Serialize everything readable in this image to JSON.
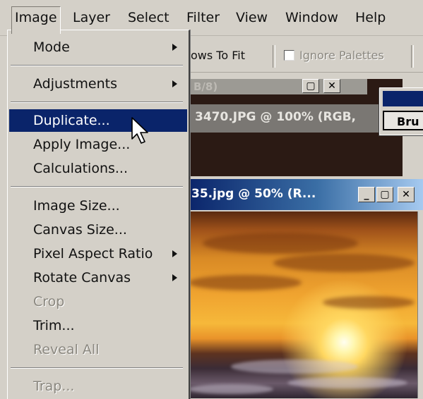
{
  "menubar": {
    "items": [
      "Image",
      "Layer",
      "Select",
      "Filter",
      "View",
      "Window",
      "Help"
    ],
    "active": "Image"
  },
  "toolbar": {
    "fit_windows_label": "ows To Fit",
    "ignore_palettes_label": "Ignore Palettes"
  },
  "windows": {
    "back_partial_title": "B/8)",
    "doc1_title": "3470.JPG @ 100% (RGB,",
    "doc2_title": "35.jpg @ 50% (R..."
  },
  "palette": {
    "tab_label": "Bru"
  },
  "image_menu": {
    "items": [
      {
        "label": "Mode",
        "submenu": true,
        "enabled": true
      },
      {
        "label": "Adjustments",
        "submenu": true,
        "enabled": true
      },
      {
        "label": "Duplicate...",
        "submenu": false,
        "enabled": true,
        "highlighted": true
      },
      {
        "label": "Apply Image...",
        "submenu": false,
        "enabled": true
      },
      {
        "label": "Calculations...",
        "submenu": false,
        "enabled": true
      },
      {
        "label": "Image Size...",
        "submenu": false,
        "enabled": true
      },
      {
        "label": "Canvas Size...",
        "submenu": false,
        "enabled": true
      },
      {
        "label": "Pixel Aspect Ratio",
        "submenu": true,
        "enabled": true
      },
      {
        "label": "Rotate Canvas",
        "submenu": true,
        "enabled": true
      },
      {
        "label": "Crop",
        "submenu": false,
        "enabled": false
      },
      {
        "label": "Trim...",
        "submenu": false,
        "enabled": true
      },
      {
        "label": "Reveal All",
        "submenu": false,
        "enabled": false
      },
      {
        "label": "Trap...",
        "submenu": false,
        "enabled": false
      }
    ]
  },
  "colors": {
    "menu_highlight": "#0a246a",
    "chrome": "#d4d0c8"
  }
}
